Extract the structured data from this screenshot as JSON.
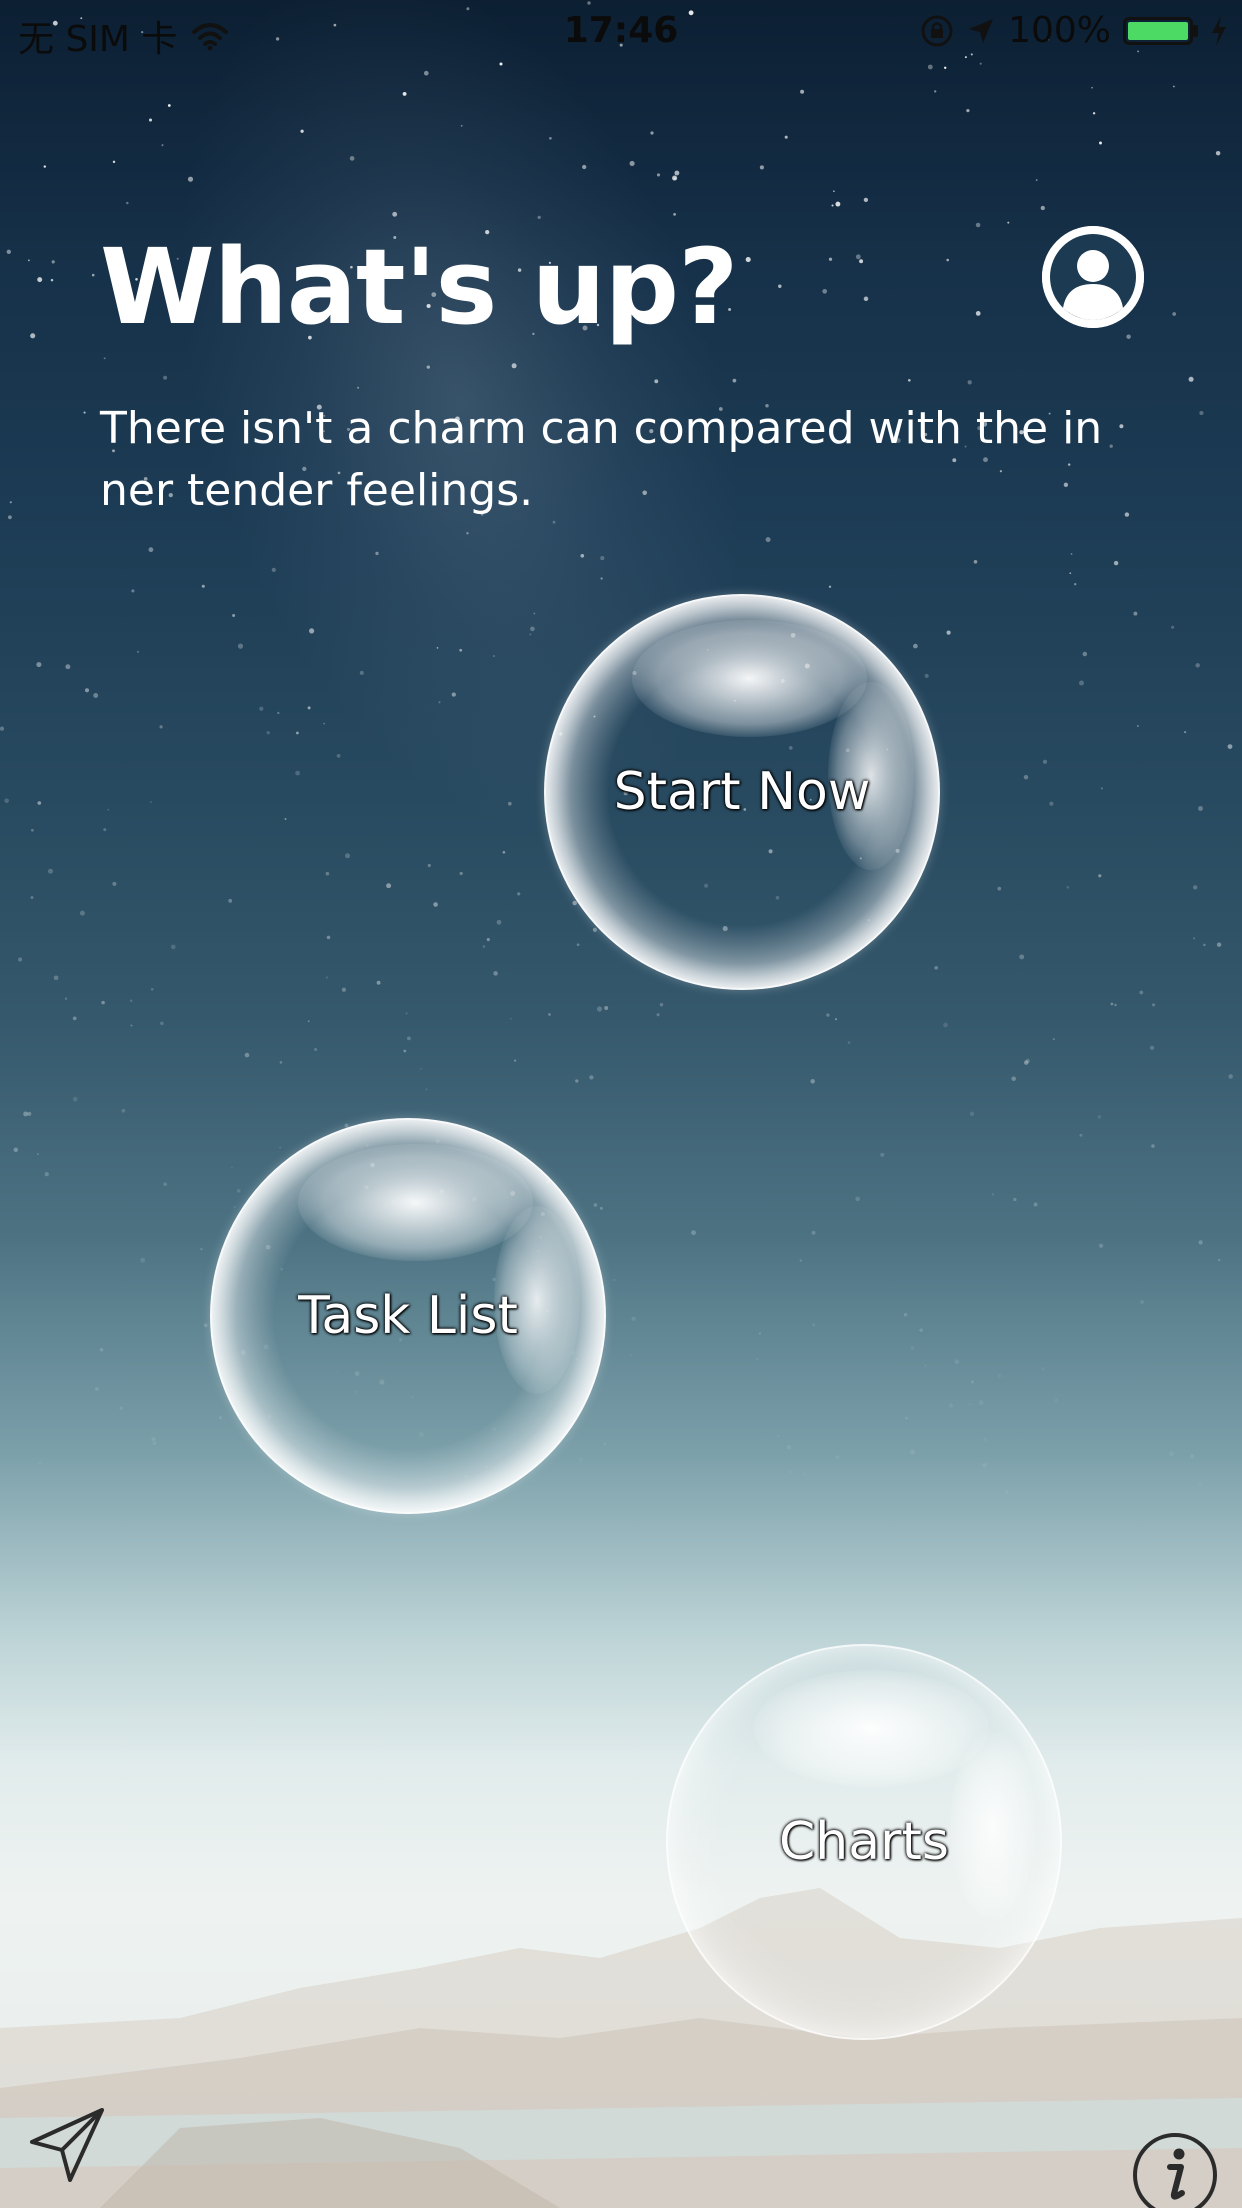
{
  "status_bar": {
    "carrier": "无 SIM 卡",
    "time": "17:46",
    "battery_percent": "100%",
    "battery_level": 1.0,
    "icons": [
      "wifi-icon",
      "orientation-lock-icon",
      "location-arrow-icon",
      "battery-icon",
      "charging-bolt-icon"
    ]
  },
  "header": {
    "title": "What's up?",
    "subtitle": "There isn't a charm can compared with the inner tender feelings.",
    "profile_icon": "user-profile-icon"
  },
  "bubbles": {
    "start_now": "Start Now",
    "task_list": "Task List",
    "charts": "Charts"
  },
  "bottom_bar": {
    "left_icon": "send-paper-plane-icon",
    "right_icon": "info-icon"
  },
  "colors": {
    "battery_fill": "#4cd964",
    "text": "#ffffff",
    "sky_top": "#0c1f33",
    "horizon": "#eef3f1"
  }
}
